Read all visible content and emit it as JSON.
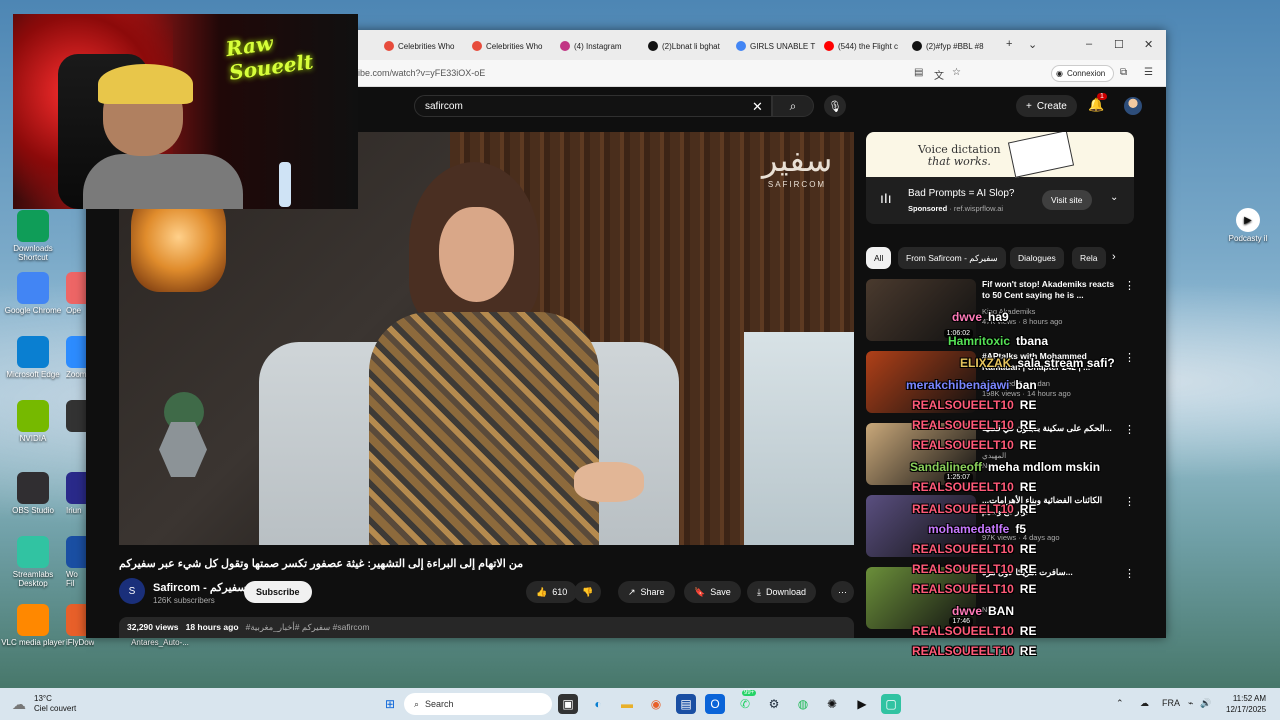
{
  "desktop": {
    "left_icons": [
      {
        "label": "Downloads\nShortcut",
        "icon": "downloads-folder-icon",
        "color": "#0f9d58"
      },
      {
        "label": "Google Chrome",
        "icon": "chrome-icon",
        "color": "#4285f4"
      },
      {
        "label": "Microsoft Edge",
        "icon": "edge-icon",
        "color": "#0a7fd1"
      },
      {
        "label": "NVIDIA",
        "icon": "nvidia-icon",
        "color": "#76b900"
      },
      {
        "label": "OBS Studio",
        "icon": "obs-icon",
        "color": "#302e31"
      },
      {
        "label": "Streamlabs\nDesktop",
        "icon": "streamlabs-icon",
        "color": "#31c3a2"
      },
      {
        "label": "VLC media player",
        "icon": "vlc-icon",
        "color": "#ff8800"
      }
    ],
    "second_col_labels": [
      "Ope",
      "Zoom",
      "",
      "Iriun",
      "Wo\nFil",
      "iFlyDown"
    ],
    "bottom_label": "Antares_Auto-...",
    "right_icon_label": "Podcasty il"
  },
  "browser": {
    "tabs": [
      {
        "label": "Celebrities Who",
        "color": "#e74c3c"
      },
      {
        "label": "Celebrities Who",
        "color": "#e74c3c"
      },
      {
        "label": "(4) Instagram",
        "color": "#c13584"
      },
      {
        "label": "(2)Lbnat li bghat",
        "color": "#111111"
      },
      {
        "label": "GIRLS UNABLE T",
        "color": "#4285f4"
      },
      {
        "label": "(544) the Flight c",
        "color": "#ff0000"
      },
      {
        "label": "(2)#fyp #BBL #8",
        "color": "#111111"
      }
    ],
    "url": "ibe.com/watch?v=yFE33iOX-oE",
    "connexion_label": "Connexion"
  },
  "youtube": {
    "search_value": "safircom",
    "create_label": "Create",
    "notif_count": "1",
    "video_logo": "SAFIRCOM",
    "video_logo_mark": "سفير",
    "video_title": "من الاتهام إلى البراءة إلى التشهير: غيثة عصفور تكسر صمتها وتقول كل شيء عبر سفيركم",
    "channel": {
      "name": "Safircom - سفيركم",
      "subs": "126K subscribers",
      "avatar_letter": "S"
    },
    "subscribe_label": "Subscribe",
    "likes": "610",
    "share_label": "Share",
    "save_label": "Save",
    "download_label": "Download",
    "description": {
      "views": "32,290 views",
      "age": "18 hours ago",
      "tags": "#سفيركم #أخبار_مغربية #safircom"
    },
    "ad": {
      "banner_line1": "Voice dictation",
      "banner_line2": "that works.",
      "title": "Bad Prompts = AI Slop?",
      "sponsored": "Sponsored",
      "domain": "ref.wisprflow.ai",
      "visit_label": "Visit site"
    },
    "chips": [
      "All",
      "From Safircom - سفيركم",
      "Dialogues",
      "Rela"
    ],
    "recommendations": [
      {
        "title": "Fif won't stop! Akademiks reacts to 50 Cent saying he is ...",
        "channel": "King Akademiks",
        "meta": "47K views · 8 hours ago",
        "duration": "1:06:02",
        "thumb_color": "#4a3a2e"
      },
      {
        "title": "#APtalks with Mohammed Ramadan | Chapter 242 | ...",
        "channel": "Mohamed Ramadan",
        "meta": "198K views · 14 hours ago",
        "duration": "",
        "thumb_color": "#b04018"
      },
      {
        "title": "الحكم على سكينة بنجلون في قضية...",
        "channel": "المهيدي",
        "meta": "New",
        "duration": "1:25:07",
        "thumb_color": "#c9a87a"
      },
      {
        "title": "الكائنات الفضائية وبناء الأهرامات... حوار مع وسيم",
        "channel": "سبيس",
        "meta": "97K views · 4 days ago",
        "duration": "",
        "thumb_color": "#5a4f80"
      },
      {
        "title": "سافرت امريكا لاول مرة...",
        "channel": "",
        "meta": "New",
        "duration": "17:46",
        "thumb_color": "#6b8f3a"
      }
    ]
  },
  "chat": [
    {
      "user": "dwve",
      "msg": "ha9",
      "color": "#ff7ab8"
    },
    {
      "user": "Hamritoxic",
      "msg": "tbana",
      "color": "#55e055"
    },
    {
      "user": "ELIXZAK",
      "msg": "sala stream safi?",
      "color": "#e6c35c"
    },
    {
      "user": "merakchibenajawi",
      "msg": "ban",
      "color": "#7a86ff"
    },
    {
      "user": "REALSOUEELT10",
      "msg": "RE",
      "color": "#ff5a78"
    },
    {
      "user": "REALSOUEELT10",
      "msg": "RE",
      "color": "#ff5a78"
    },
    {
      "user": "REALSOUEELT10",
      "msg": "RE",
      "color": "#ff5a78"
    },
    {
      "user": "Sandalineoff",
      "msg": "meha mdlom mskin",
      "color": "#8bd05a"
    },
    {
      "user": "REALSOUEELT10",
      "msg": "RE",
      "color": "#ff5a78"
    },
    {
      "user": "REALSOUEELT10",
      "msg": "RE",
      "color": "#ff5a78"
    },
    {
      "user": "mohamedatlfe",
      "msg": "f5",
      "color": "#c87aff"
    },
    {
      "user": "REALSOUEELT10",
      "msg": "RE",
      "color": "#ff5a78"
    },
    {
      "user": "REALSOUEELT10",
      "msg": "RE",
      "color": "#ff5a78"
    },
    {
      "user": "REALSOUEELT10",
      "msg": "RE",
      "color": "#ff5a78"
    },
    {
      "user": "dwve",
      "msg": "BAN",
      "color": "#ff7ab8"
    },
    {
      "user": "REALSOUEELT10",
      "msg": "RE",
      "color": "#ff5a78"
    },
    {
      "user": "REALSOUEELT10",
      "msg": "RE",
      "color": "#ff5a78"
    }
  ],
  "webcam": {
    "neon_line1": "Raw",
    "neon_line2": "Soueelt"
  },
  "taskbar": {
    "weather_temp": "13°C",
    "weather_desc": "Ciel couvert",
    "search_placeholder": "Search",
    "lang": "FRA",
    "time": "11:52 AM",
    "date": "12/17/2025",
    "whatsapp_badge": "99+"
  }
}
